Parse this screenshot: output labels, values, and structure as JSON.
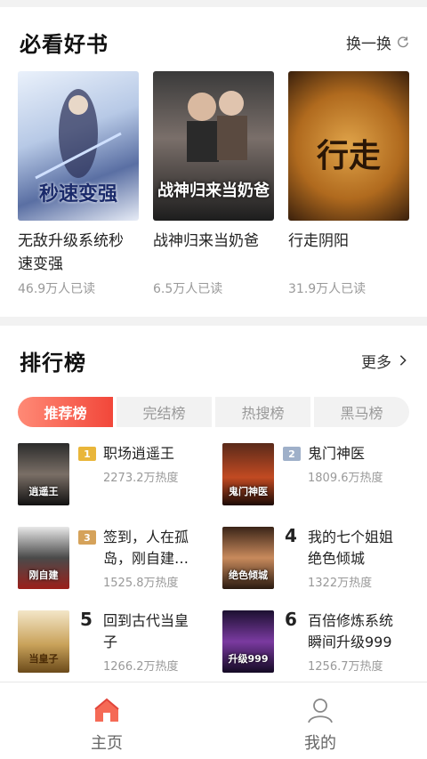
{
  "must_read": {
    "title": "必看好书",
    "refresh_label": "换一换",
    "books": [
      {
        "title_line1": "无敌升级系统秒",
        "title_line2": "速变强",
        "reads": "46.9万人已读",
        "cover_text": "秒速变强"
      },
      {
        "title_line1": "战神归来当奶爸",
        "title_line2": "",
        "reads": "6.5万人已读",
        "cover_text": "战神归来当奶爸"
      },
      {
        "title_line1": "行走阴阳",
        "title_line2": "",
        "reads": "31.9万人已读",
        "cover_text": "行走"
      }
    ]
  },
  "ranking": {
    "title": "排行榜",
    "more_label": "更多",
    "tabs": [
      "推荐榜",
      "完结榜",
      "热搜榜",
      "黑马榜"
    ],
    "items": [
      {
        "rank": "1",
        "name_line1": "职场逍遥王",
        "name_line2": "",
        "heat": "2273.2万热度",
        "cover_text": "逍遥王"
      },
      {
        "rank": "2",
        "name_line1": "鬼门神医",
        "name_line2": "",
        "heat": "1809.6万热度",
        "cover_text": "鬼门神医"
      },
      {
        "rank": "3",
        "name_line1": "签到，人在孤",
        "name_line2": "岛，刚自建…",
        "heat": "1525.8万热度",
        "cover_text": "刚自建"
      },
      {
        "rank": "4",
        "name_line1": "我的七个姐姐",
        "name_line2": "绝色倾城",
        "heat": "1322万热度",
        "cover_text": "绝色倾城"
      },
      {
        "rank": "5",
        "name_line1": "回到古代当皇",
        "name_line2": "子",
        "heat": "1266.2万热度",
        "cover_text": "当皇子"
      },
      {
        "rank": "6",
        "name_line1": "百倍修炼系统",
        "name_line2": "瞬间升级999",
        "heat": "1256.7万热度",
        "cover_text": "升级999"
      }
    ]
  },
  "tabbar": {
    "home_label": "主页",
    "mine_label": "我的"
  },
  "colors": {
    "accent": "#f2473a",
    "accent_light": "#ff8a76"
  }
}
